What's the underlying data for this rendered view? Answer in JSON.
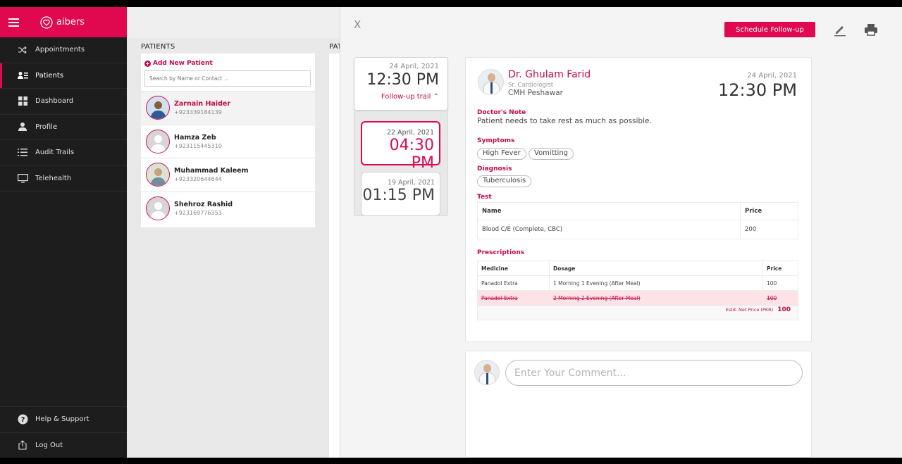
{
  "app": {
    "brand": "aibers"
  },
  "sidebar": {
    "items": [
      {
        "label": "Appointments"
      },
      {
        "label": "Patients"
      },
      {
        "label": "Dashboard"
      },
      {
        "label": "Profile"
      },
      {
        "label": "Audit Trails"
      },
      {
        "label": "Telehealth"
      }
    ],
    "bottom": [
      {
        "label": "Help & Support"
      },
      {
        "label": "Log Out"
      }
    ]
  },
  "patients": {
    "title": "PATIENTS",
    "second_title": "PAT",
    "add_label": "Add New Patient",
    "search_placeholder": "Search by Name or Contact ...",
    "list": [
      {
        "name": "Zarnain Haider",
        "phone": "+923339184139"
      },
      {
        "name": "Hamza Zeb",
        "phone": "+923115445310"
      },
      {
        "name": "Muhammad Kaleem",
        "phone": "+923320644644"
      },
      {
        "name": "Shehroz Rashid",
        "phone": "+923169776353"
      }
    ]
  },
  "panel": {
    "close": "X",
    "schedule_label": "Schedule Follow-up",
    "trail": {
      "date": "24 April, 2021",
      "time": "12:30 PM",
      "link": "Follow-up trail ⌃",
      "cards": [
        {
          "date": "22 April, 2021",
          "time": "04:30 PM"
        },
        {
          "date": "19 April, 2021",
          "time": "01:15 PM"
        }
      ]
    },
    "doctor": {
      "name": "Dr. Ghulam Farid",
      "specialty": "Sr. Cardiologist",
      "hospital": "CMH Peshawar",
      "date": "24 April, 2021",
      "time": "12:30 PM"
    },
    "note_label": "Doctor's Note",
    "note": "Patient needs to take rest as much as possible.",
    "symptoms_label": "Symptoms",
    "symptoms": [
      "High Fever",
      "Vomitting"
    ],
    "diagnosis_label": "Diagnosis",
    "diagnosis": [
      "Tuberculosis"
    ],
    "test_label": "Test",
    "test_headers": [
      "Name",
      "Price"
    ],
    "tests": [
      {
        "name": "Blood C/E (Complete, CBC)",
        "price": "200"
      }
    ],
    "rx_label": "Prescriptions",
    "rx_headers": [
      "Medicine",
      "Dosage",
      "Price"
    ],
    "rx": [
      {
        "medicine": "Panadol Extra",
        "dosage": "1 Morning 1 Evening (After Meal)",
        "price": "100"
      },
      {
        "medicine": "Panadol Extra",
        "dosage": "2 Morning 2 Evening (After Meal)",
        "price": "100"
      }
    ],
    "net_label": "Estd. Net Price (PKR)",
    "net_value": "100",
    "comment_placeholder": "Enter Your Comment..."
  },
  "colors": {
    "accent": "#e0094f",
    "sidebar": "#1d1d1d"
  }
}
